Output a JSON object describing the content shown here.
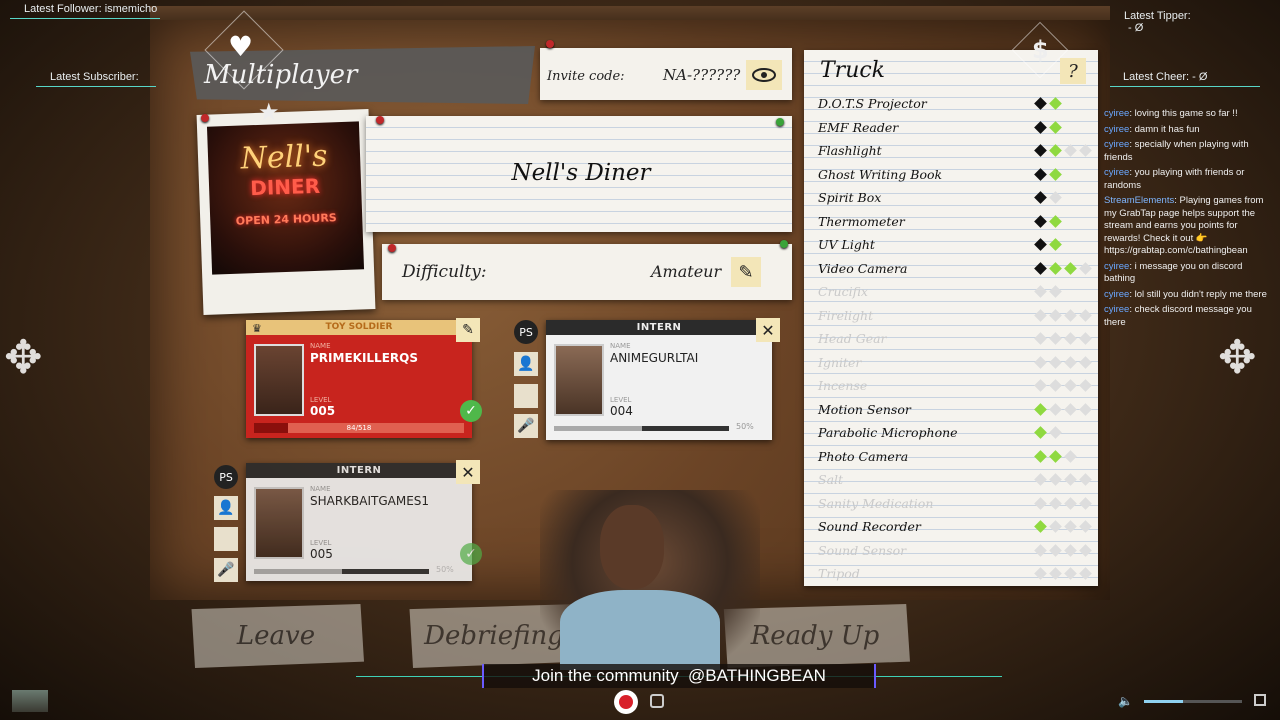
{
  "overlay": {
    "latest_follower": "Latest Follower: ismemicho",
    "latest_subscriber": "Latest Subscriber:",
    "latest_tipper": "Latest Tipper:",
    "latest_tipper_value": "- Ø",
    "latest_cheer": "Latest Cheer: - Ø",
    "banner": "Join the community  @BATHINGBEAN"
  },
  "lobby": {
    "title": "Multiplayer",
    "invite_label": "Invite code:",
    "invite_code": "NA-??????",
    "map_name": "Nell's Diner",
    "difficulty_label": "Difficulty:",
    "difficulty_value": "Amateur",
    "photo_text_1": "Nell's",
    "photo_text_2": "DINER",
    "photo_text_3": "OPEN 24 HOURS"
  },
  "players": [
    {
      "title": "TOY SOLDIER",
      "name_label": "NAME",
      "name": "PRIMEKILLERQS",
      "level_label": "LEVEL",
      "level": "005",
      "xp": "84/518",
      "xp_fraction": 0.16,
      "ready": true
    },
    {
      "title": "INTERN",
      "name_label": "NAME",
      "name": "ANIMEGURLTAI",
      "level_label": "LEVEL",
      "level": "004",
      "volume": "50%",
      "volume_fraction": 0.5,
      "ready": false
    },
    {
      "title": "INTERN",
      "name_label": "NAME",
      "name": "SHARKBAITGAMES1",
      "level_label": "LEVEL",
      "level": "005",
      "volume": "50%",
      "volume_fraction": 0.5,
      "ready": true
    }
  ],
  "truck": {
    "title": "Truck",
    "help": "?",
    "items": [
      {
        "label": "D.O.T.S Projector",
        "dim": false,
        "dots": [
          "b",
          "gr",
          "x",
          "x"
        ]
      },
      {
        "label": "EMF Reader",
        "dim": false,
        "dots": [
          "b",
          "gr",
          "x",
          "x"
        ]
      },
      {
        "label": "Flashlight",
        "dim": false,
        "dots": [
          "b",
          "gr",
          "w",
          "w"
        ]
      },
      {
        "label": "Ghost Writing Book",
        "dim": false,
        "dots": [
          "b",
          "gr",
          "x",
          "x"
        ]
      },
      {
        "label": "Spirit Box",
        "dim": false,
        "dots": [
          "b",
          "w",
          "x",
          "x"
        ]
      },
      {
        "label": "Thermometer",
        "dim": false,
        "dots": [
          "b",
          "gr",
          "x",
          "x"
        ]
      },
      {
        "label": "UV Light",
        "dim": false,
        "dots": [
          "b",
          "gr",
          "x",
          "x"
        ]
      },
      {
        "label": "Video Camera",
        "dim": false,
        "dots": [
          "b",
          "gr",
          "gr",
          "w"
        ]
      },
      {
        "label": "Crucifix",
        "dim": true,
        "dots": [
          "w",
          "w",
          "x",
          "x"
        ]
      },
      {
        "label": "Firelight",
        "dim": true,
        "dots": [
          "w",
          "w",
          "w",
          "w"
        ]
      },
      {
        "label": "Head Gear",
        "dim": true,
        "dots": [
          "w",
          "w",
          "w",
          "w"
        ]
      },
      {
        "label": "Igniter",
        "dim": true,
        "dots": [
          "w",
          "w",
          "w",
          "w"
        ]
      },
      {
        "label": "Incense",
        "dim": true,
        "dots": [
          "w",
          "w",
          "w",
          "w"
        ]
      },
      {
        "label": "Motion Sensor",
        "dim": false,
        "dots": [
          "gr",
          "w",
          "w",
          "w"
        ]
      },
      {
        "label": "Parabolic Microphone",
        "dim": false,
        "dots": [
          "gr",
          "w",
          "x",
          "x"
        ]
      },
      {
        "label": "Photo Camera",
        "dim": false,
        "dots": [
          "gr",
          "gr",
          "w",
          "x"
        ]
      },
      {
        "label": "Salt",
        "dim": true,
        "dots": [
          "w",
          "w",
          "w",
          "w"
        ]
      },
      {
        "label": "Sanity Medication",
        "dim": true,
        "dots": [
          "w",
          "w",
          "w",
          "w"
        ]
      },
      {
        "label": "Sound Recorder",
        "dim": false,
        "dots": [
          "gr",
          "w",
          "w",
          "w"
        ]
      },
      {
        "label": "Sound Sensor",
        "dim": true,
        "dots": [
          "w",
          "w",
          "w",
          "w"
        ]
      },
      {
        "label": "Tripod",
        "dim": true,
        "dots": [
          "w",
          "w",
          "w",
          "w"
        ]
      }
    ]
  },
  "buttons": {
    "leave": "Leave",
    "debriefing": "Debriefing",
    "ready_up": "Ready Up"
  },
  "chat": [
    {
      "name": "cyiree",
      "text": "loving this game so far !!"
    },
    {
      "name": "cyiree",
      "text": "damn it has fun"
    },
    {
      "name": "cyiree",
      "text": "specially when playing with friends"
    },
    {
      "name": "cyiree",
      "text": "you playing with friends or randoms"
    },
    {
      "name": "StreamElements",
      "text": "Playing games from my GrabTap page helps support the stream and earns you points for rewards! Check it out 👉 https://grabtap.com/c/bathingbean"
    },
    {
      "name": "cyiree",
      "text": "i message you on discord bathing"
    },
    {
      "name": "cyiree",
      "text": "lol still you didn't reply me there"
    },
    {
      "name": "cyiree",
      "text": "check discord message you there"
    }
  ],
  "player_controls": {
    "volume_fraction": 0.4
  }
}
